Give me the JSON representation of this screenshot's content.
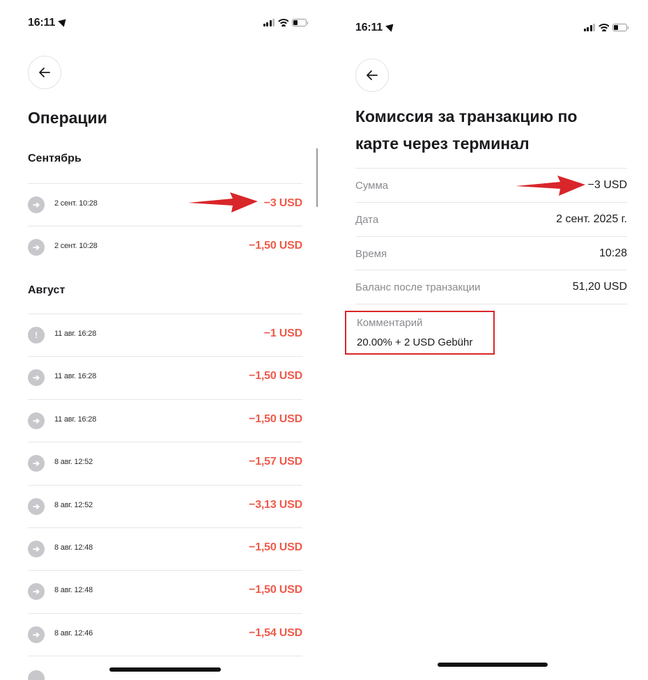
{
  "left": {
    "status_time": "16:11",
    "title": "Операции",
    "sections": [
      {
        "title": "Сентябрь",
        "items": [
          {
            "date": "2 сент. 10:28",
            "amount": "−3 USD",
            "icon": "arrow-right-icon"
          },
          {
            "date": "2 сент. 10:28",
            "amount": "−1,50 USD",
            "icon": "arrow-right-icon"
          }
        ]
      },
      {
        "title": "Август",
        "items": [
          {
            "date": "11 авг. 16:28",
            "amount": "−1 USD",
            "icon": "exclamation-icon"
          },
          {
            "date": "11 авг. 16:28",
            "amount": "−1,50 USD",
            "icon": "arrow-right-icon"
          },
          {
            "date": "11 авг. 16:28",
            "amount": "−1,50 USD",
            "icon": "arrow-right-icon"
          },
          {
            "date": "8 авг. 12:52",
            "amount": "−1,57 USD",
            "icon": "arrow-right-icon"
          },
          {
            "date": "8 авг. 12:52",
            "amount": "−3,13 USD",
            "icon": "arrow-right-icon"
          },
          {
            "date": "8 авг. 12:48",
            "amount": "−1,50 USD",
            "icon": "arrow-right-icon"
          },
          {
            "date": "8 авг. 12:48",
            "amount": "−1,50 USD",
            "icon": "arrow-right-icon"
          },
          {
            "date": "8 авг. 12:46",
            "amount": "−1,54 USD",
            "icon": "arrow-right-icon"
          }
        ]
      }
    ]
  },
  "right": {
    "status_time": "16:11",
    "title": "Комиссия за транзакцию по карте через терминал",
    "details": [
      {
        "label": "Сумма",
        "value": "−3 USD"
      },
      {
        "label": "Дата",
        "value": "2 сент. 2025 г."
      },
      {
        "label": "Время",
        "value": "10:28"
      },
      {
        "label": "Баланс после транзакции",
        "value": "51,20 USD"
      }
    ],
    "comment_label": "Комментарий",
    "comment_text": "20.00% + 2 USD Gebühr"
  },
  "colors": {
    "negative_amount": "#ef5a4a",
    "annotation_red": "#d9262a",
    "icon_gray": "#c7c7cc"
  }
}
